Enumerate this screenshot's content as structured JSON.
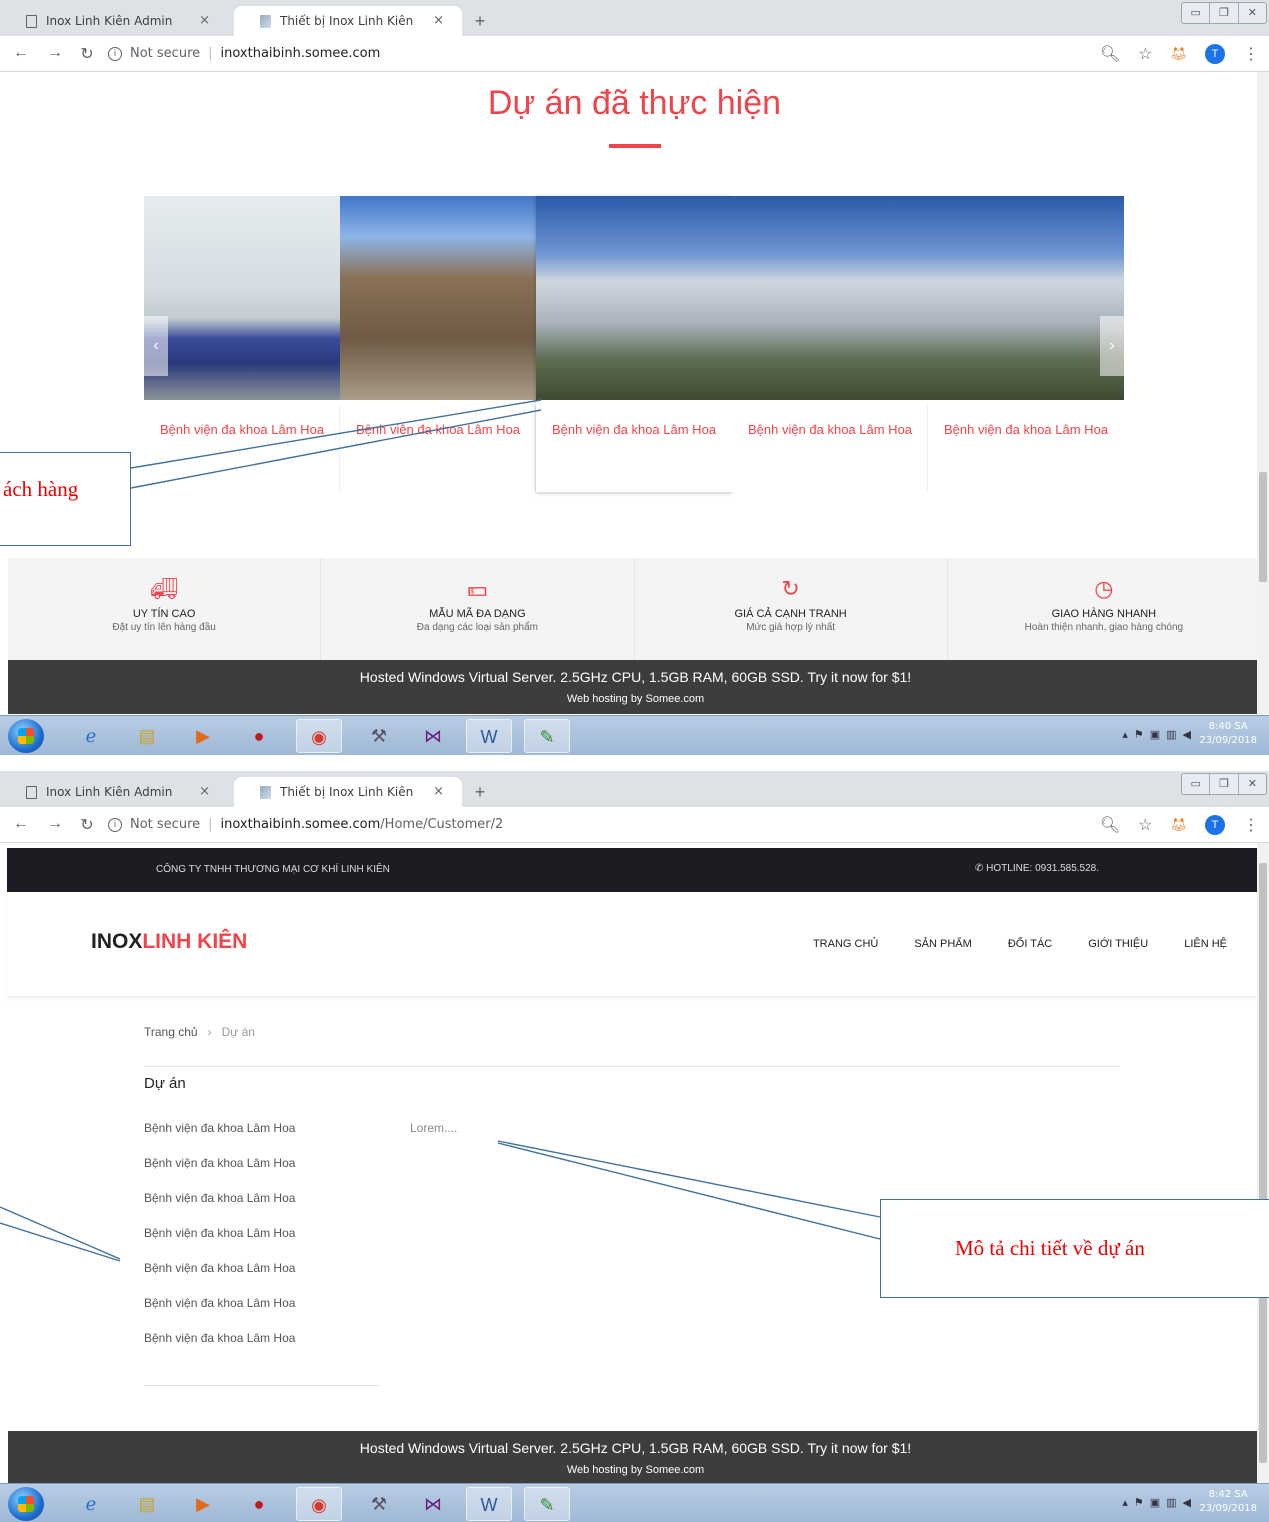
{
  "browser": {
    "tabs": [
      {
        "title": "Inox Linh Kiên Admin",
        "close": "×"
      },
      {
        "title": "Thiết bị Inox Linh Kiên",
        "close": "×"
      }
    ],
    "new_tab": "+",
    "not_secure": "Not secure",
    "url_a": "inoxthaibinh.somee.com",
    "url_b_host": "inoxthaibinh.somee.com",
    "url_b_path": "/Home/Customer/2",
    "profile_initial": "T"
  },
  "page_a": {
    "section_title": "Dự án đã thực hiện",
    "projects": [
      {
        "caption": "Bệnh viện đa khoa Lâm Hoa"
      },
      {
        "caption": "Bệnh viện đa khoa Lâm Hoa"
      },
      {
        "caption": "Bệnh viện đa khoa Lâm Hoa"
      },
      {
        "caption": "Bệnh viện đa khoa Lâm Hoa"
      },
      {
        "caption": "Bệnh viện đa khoa Lâm Hoa"
      }
    ],
    "features": [
      {
        "title": "UY TÍN CAO",
        "subtitle": "Đặt uy tín lên hàng đầu"
      },
      {
        "title": "MẪU MÃ ĐA DẠNG",
        "subtitle": "Đa dạng các loại sản phẩm"
      },
      {
        "title": "GIÁ CẢ CẠNH TRANH",
        "subtitle": "Mức giá hợp lý nhất"
      },
      {
        "title": "GIAO HÀNG NHANH",
        "subtitle": "Hoàn thiện nhanh, giao hàng chóng"
      }
    ],
    "callout_text": "ách hàng"
  },
  "hosting": {
    "banner": "Hosted Windows Virtual Server. 2.5GHz CPU, 1.5GB RAM, 60GB SSD. Try it now for $1!",
    "credit": "Web hosting by Somee.com"
  },
  "taskbar_a": {
    "time": "8:40 SA",
    "date": "23/09/2018"
  },
  "taskbar_b": {
    "time": "8:42 SA",
    "date": "23/09/2018"
  },
  "page_b": {
    "company": "CÔNG TY TNHH THƯƠNG MẠI CƠ KHÍ LINH KIÊN",
    "hotline": "HOTLINE: 0931.585.528.",
    "logo_black": "INOX",
    "logo_red": "LINH KIÊN",
    "nav": [
      "TRANG CHỦ",
      "SẢN PHẨM",
      "ĐỐI TÁC",
      "GIỚI THIỆU",
      "LIÊN HỆ"
    ],
    "breadcrumb_home": "Trang chủ",
    "breadcrumb_sep": "›",
    "breadcrumb_current": "Dự án",
    "section_title": "Dự án",
    "projects": [
      "Bệnh viện đa khoa Lâm Hoa",
      "Bệnh viện đa khoa Lâm Hoa",
      "Bệnh viện đa khoa Lâm Hoa",
      "Bệnh viện đa khoa Lâm Hoa",
      "Bệnh viện đa khoa Lâm Hoa",
      "Bệnh viện đa khoa Lâm Hoa",
      "Bệnh viện đa khoa Lâm Hoa"
    ],
    "description": "Lorem....",
    "callout_text": "Mô tả chi tiết về dự án"
  }
}
